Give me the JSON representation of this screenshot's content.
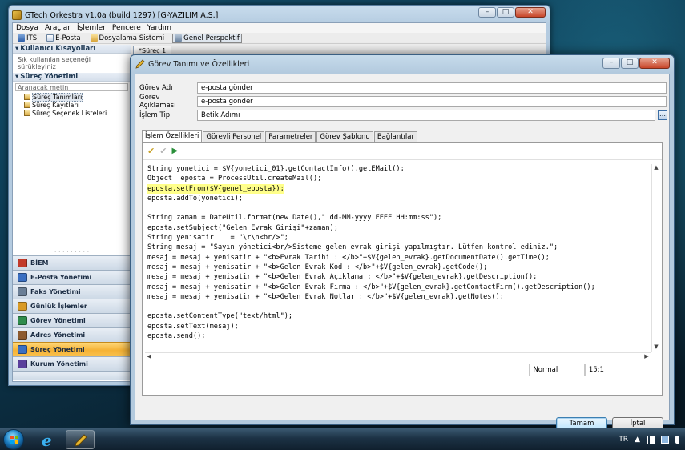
{
  "main_window": {
    "title": "GTech Orkestra v1.0a (build 1297) [G-YAZILIM A.S.]",
    "menu": [
      "Dosya",
      "Araçlar",
      "İşlemler",
      "Pencere",
      "Yardım"
    ],
    "toolbar": {
      "its": "ITS",
      "eposta": "E-Posta",
      "dosyalama": "Dosyalama Sistemi",
      "perspektif": "Genel Perspektif"
    },
    "left_panel": {
      "shortcuts_header": "Kullanıcı Kısayolları",
      "shortcuts_hint": "Sık kullanılan seçeneği sürükleyiniz",
      "process_header": "Süreç Yönetimi",
      "search_placeholder": "Aranacak metin",
      "tree": [
        "Süreç Tanımları",
        "Süreç Kayıtları",
        "Süreç Seçenek Listeleri"
      ],
      "nav": [
        {
          "label": "BİEM",
          "color": "#c23a2a"
        },
        {
          "label": "E-Posta Yönetimi",
          "color": "#3a6fc2"
        },
        {
          "label": "Faks Yönetimi",
          "color": "#6b7f96"
        },
        {
          "label": "Günlük İşlemler",
          "color": "#d99a25"
        },
        {
          "label": "Görev Yönetimi",
          "color": "#2f8c4c"
        },
        {
          "label": "Adres Yönetimi",
          "color": "#8c5a2f"
        },
        {
          "label": "Süreç Yönetimi",
          "color": "#3a6fc2",
          "active": true
        },
        {
          "label": "Kurum Yönetimi",
          "color": "#5a3f9c"
        }
      ]
    },
    "editor_tab": "*Süreç 1"
  },
  "dialog": {
    "title": "Görev Tanımı ve Özellikleri",
    "fields": {
      "gorev_adi": {
        "label": "Görev Adı",
        "value": "e-posta gönder"
      },
      "gorev_aciklamasi": {
        "label": "Görev Açıklaması",
        "value": "e-posta gönder"
      },
      "islem_tipi": {
        "label": "İşlem Tipi",
        "value": "Betik Adımı"
      }
    },
    "tabs": [
      "İşlem Özellikleri",
      "Görevli Personel",
      "Parametreler",
      "Görev Şablonu",
      "Bağlantılar"
    ],
    "code_lines": [
      "String yonetici = $V{yonetici_01}.getContactInfo().getEMail();",
      "Object  eposta = ProcessUtil.createMail();",
      "eposta.setFrom($V{genel_eposta});",
      "eposta.addTo(yonetici);",
      "",
      "String zaman = DateUtil.format(new Date(),\" dd-MM-yyyy EEEE HH:mm:ss\");",
      "eposta.setSubject(\"Gelen Evrak Girişi\"+zaman);",
      "String yenisatir    = \"\\r\\n<br/>\";",
      "String mesaj = \"Sayın yönetici<br/>Sisteme gelen evrak girişi yapılmıştır. Lütfen kontrol ediniz.\";",
      "mesaj = mesaj + yenisatir + \"<b>Evrak Tarihi : </b>\"+$V{gelen_evrak}.getDocumentDate().getTime();",
      "mesaj = mesaj + yenisatir + \"<b>Gelen Evrak Kod : </b>\"+$V{gelen_evrak}.getCode();",
      "mesaj = mesaj + yenisatir + \"<b>Gelen Evrak Açıklama : </b>\"+$V{gelen_evrak}.getDescription();",
      "mesaj = mesaj + yenisatir + \"<b>Gelen Evrak Firma : </b>\"+$V{gelen_evrak}.getContactFirm().getDescription();",
      "mesaj = mesaj + yenisatir + \"<b>Gelen Evrak Notlar : </b>\"+$V{gelen_evrak}.getNotes();",
      "",
      "eposta.setContentType(\"text/html\");",
      "eposta.setText(mesaj);",
      "eposta.send();"
    ],
    "highlighted_line": 2,
    "status": {
      "mode": "Normal",
      "position": "15:1"
    },
    "buttons": {
      "ok": "Tamam",
      "cancel": "İptal"
    }
  },
  "taskbar": {
    "language": "TR"
  }
}
